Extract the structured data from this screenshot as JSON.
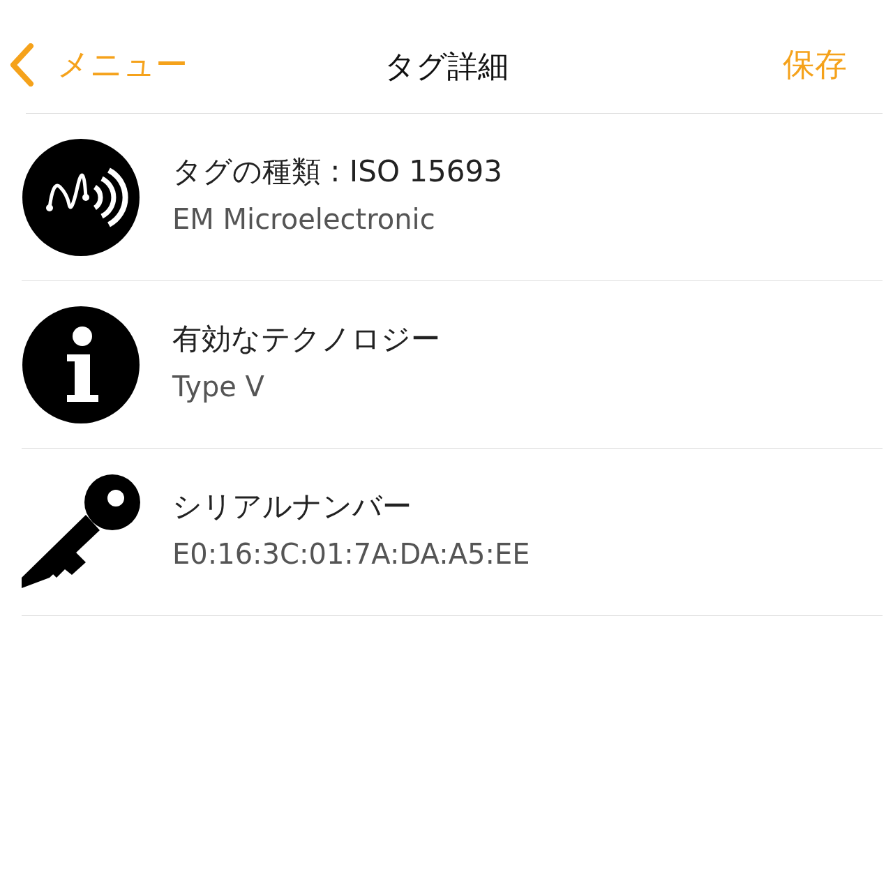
{
  "nav": {
    "back_label": "メニュー",
    "title": "タグ詳細",
    "save_label": "保存"
  },
  "items": [
    {
      "kind": "nfc",
      "title": "タグの種類 : ISO 15693",
      "subtitle": "EM Microelectronic"
    },
    {
      "kind": "info",
      "title": "有効なテクノロジー",
      "subtitle": "Type V"
    },
    {
      "kind": "key",
      "title": "シリアルナンバー",
      "subtitle": "E0:16:3C:01:7A:DA:A5:EE"
    }
  ]
}
